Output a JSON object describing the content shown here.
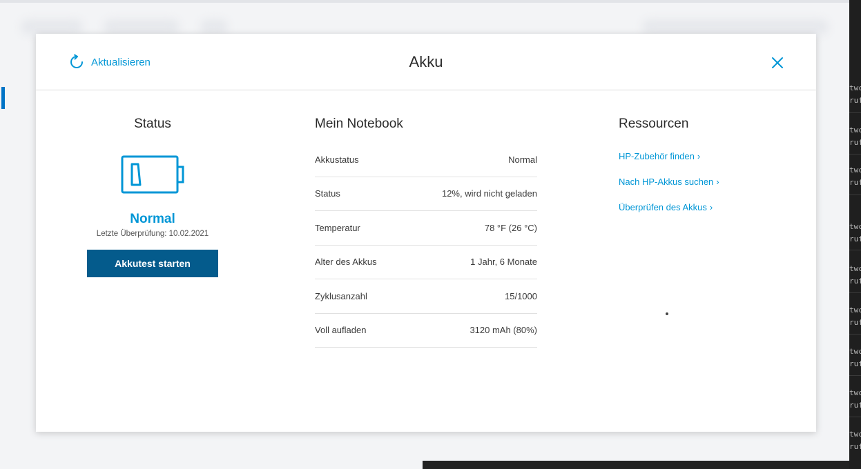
{
  "modal": {
    "title": "Akku",
    "refresh_label": "Aktualisieren",
    "close_icon": "close-icon",
    "accent_color": "#0096d6"
  },
  "status": {
    "heading": "Status",
    "battery_icon": "battery-low-icon",
    "value": "Normal",
    "last_check": "Letzte Überprüfung: 10.02.2021",
    "button_label": "Akkutest starten"
  },
  "notebook": {
    "heading": "Mein Notebook",
    "rows": [
      {
        "label": "Akkustatus",
        "value": "Normal"
      },
      {
        "label": "Status",
        "value": "12%, wird nicht geladen"
      },
      {
        "label": "Temperatur",
        "value": "78 °F (26 °C)"
      },
      {
        "label": "Alter des Akkus",
        "value": "1 Jahr, 6 Monate"
      },
      {
        "label": "Zyklusanzahl",
        "value": "15/1000"
      },
      {
        "label": "Voll aufladen",
        "value": "3120 mAh (80%)"
      }
    ]
  },
  "resources": {
    "heading": "Ressourcen",
    "links": [
      {
        "label": "HP-Zubehör finden"
      },
      {
        "label": "Nach HP-Akkus suchen"
      },
      {
        "label": "Überprüfen des Akkus"
      }
    ]
  },
  "side_strip": {
    "items": [
      "twc",
      "rufe",
      "twc",
      "rufe",
      "twc",
      "rufe",
      "twc",
      "rufe",
      "twc",
      "rufe",
      "twc",
      "rufe",
      "twc",
      "rufe",
      "twc",
      "rufe",
      "twc",
      "rufe"
    ]
  }
}
